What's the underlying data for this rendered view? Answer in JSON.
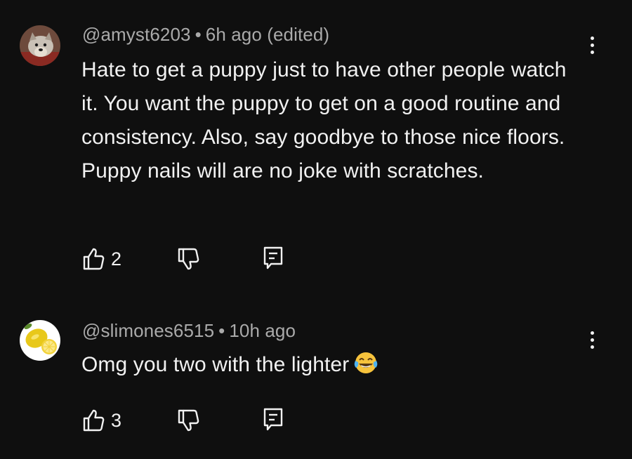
{
  "comments": [
    {
      "author": "@amyst6203",
      "separator": "•",
      "time": "6h ago (edited)",
      "text": "Hate to get a puppy just to have other people watch it.  You want the puppy to get on a good routine and consistency.  Also, say goodbye to those nice floors. Puppy nails will are no joke with scratches.",
      "likes": "2",
      "avatar_icon": "dog-avatar",
      "like_icon": "thumbs-up-icon",
      "dislike_icon": "thumbs-down-icon",
      "reply_icon": "reply-icon",
      "menu_icon": "more-vertical-icon"
    },
    {
      "author": "@slimones6515",
      "separator": "•",
      "time": "10h ago",
      "text": "Omg you two with the lighter",
      "emoji": "face-with-tears-of-joy",
      "likes": "3",
      "avatar_icon": "lemon-avatar",
      "like_icon": "thumbs-up-icon",
      "dislike_icon": "thumbs-down-icon",
      "reply_icon": "reply-icon",
      "menu_icon": "more-vertical-icon"
    }
  ],
  "colors": {
    "background": "#0f0f0f",
    "text_primary": "#f1f1f1",
    "text_secondary": "#aaaaaa"
  }
}
